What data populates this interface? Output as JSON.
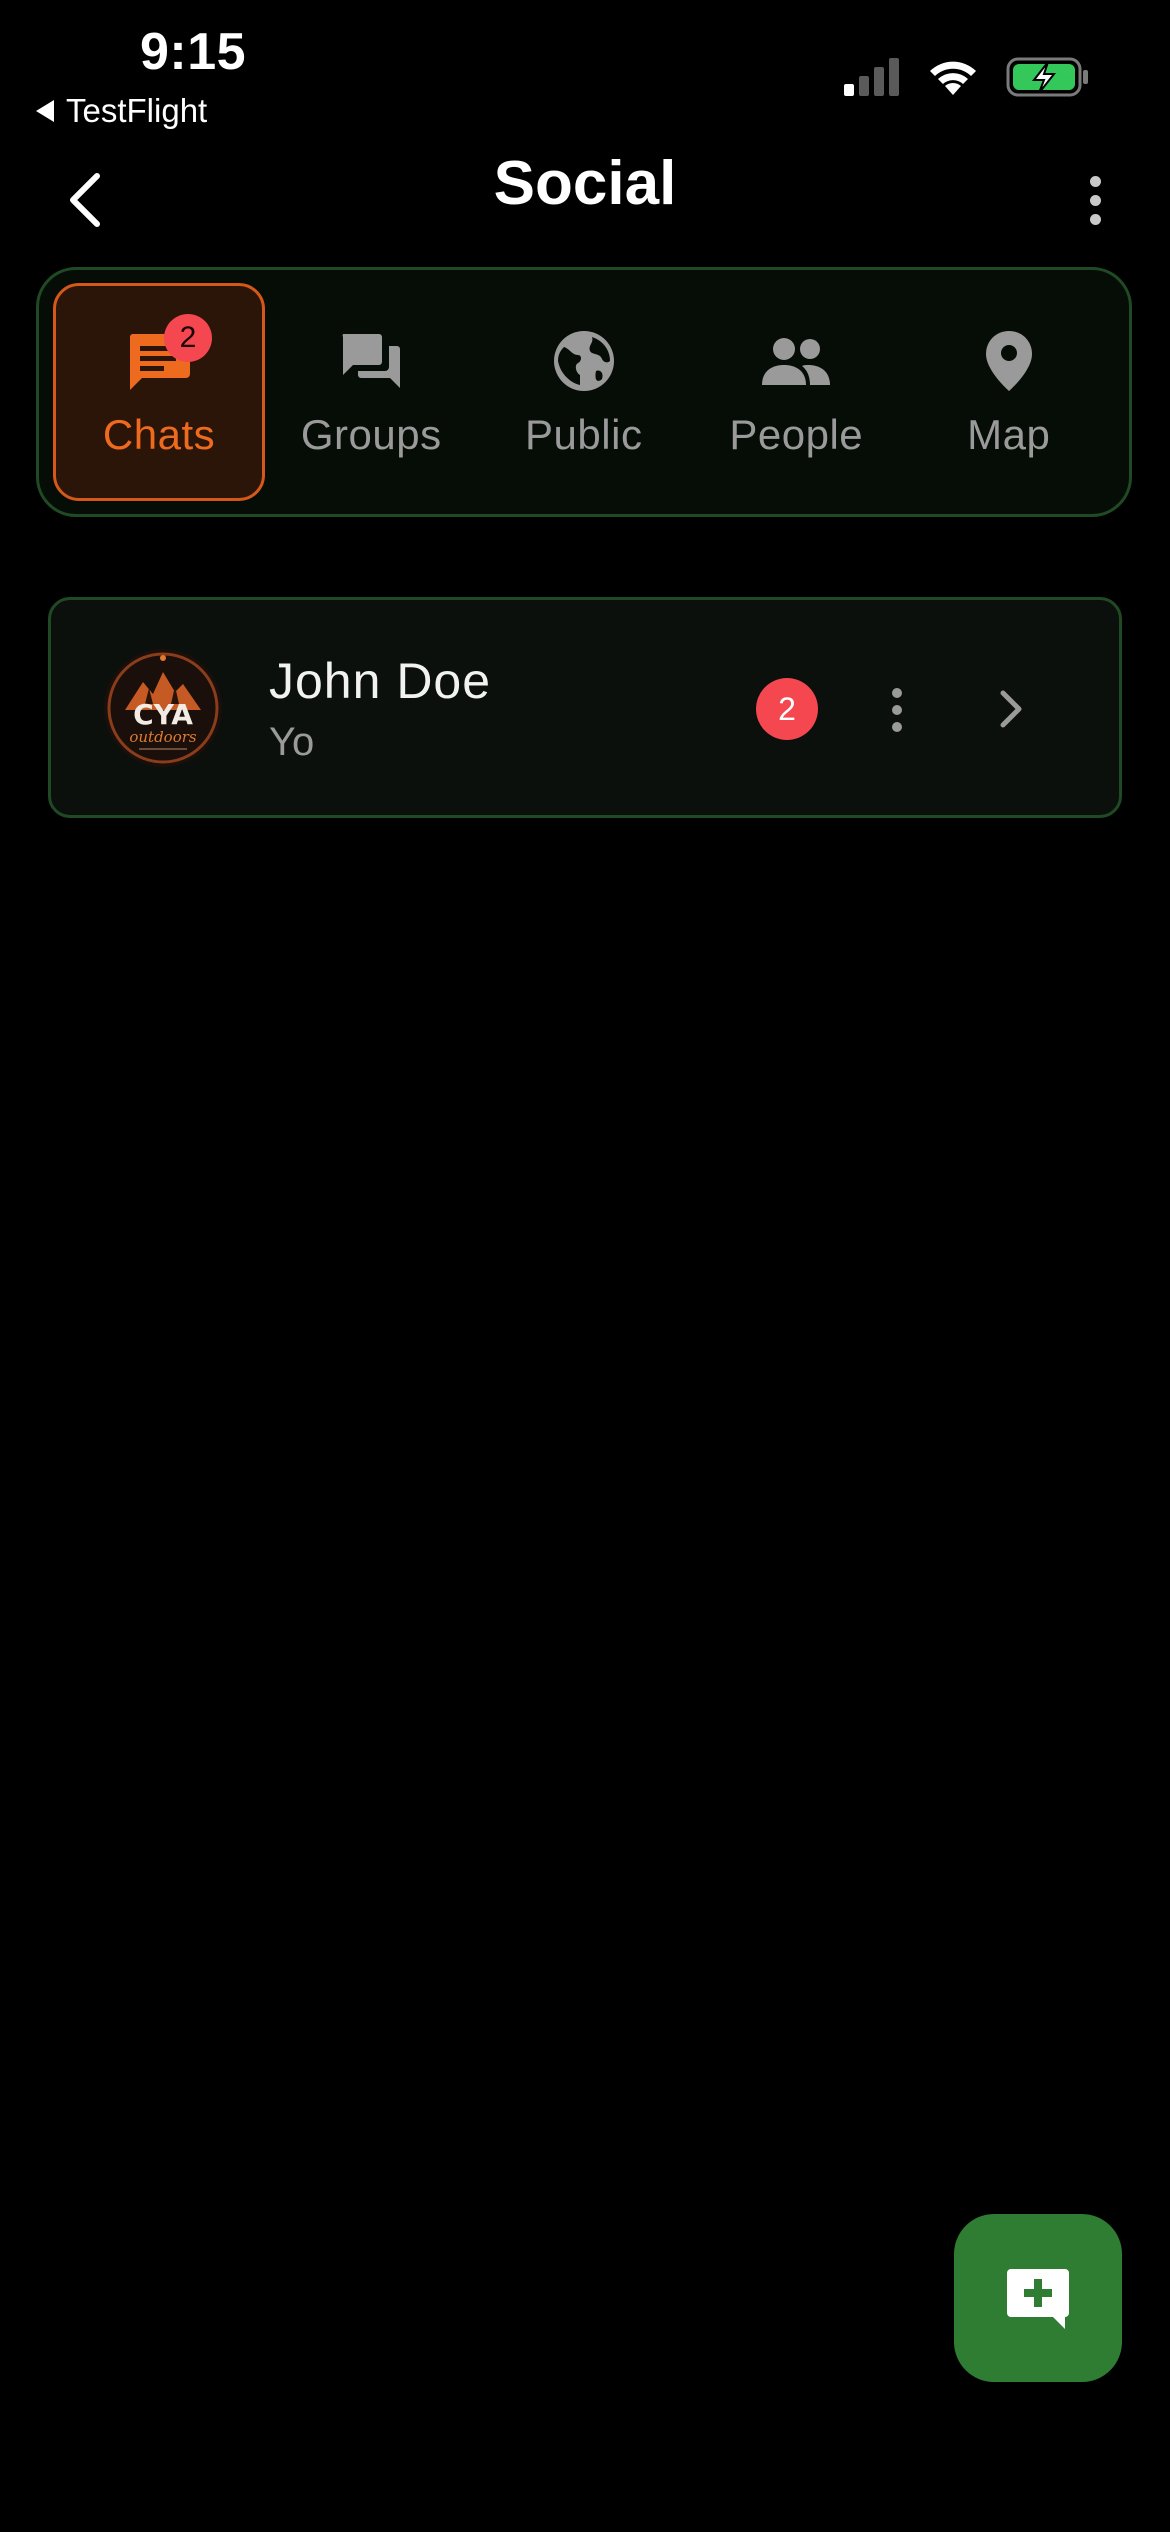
{
  "status_bar": {
    "time": "9:15",
    "back_app": "TestFlight",
    "signal_icon": "cellular-signal-icon",
    "wifi_icon": "wifi-icon",
    "battery_icon": "battery-charging-icon",
    "battery_color": "#34c759"
  },
  "header": {
    "title": "Social",
    "back_icon": "chevron-left-icon",
    "menu_icon": "more-vertical-icon"
  },
  "tabs": [
    {
      "label": "Chats",
      "icon": "chat-bubble-icon",
      "active": true,
      "badge": "2"
    },
    {
      "label": "Groups",
      "icon": "forum-icon",
      "active": false
    },
    {
      "label": "Public",
      "icon": "globe-icon",
      "active": false
    },
    {
      "label": "People",
      "icon": "people-icon",
      "active": false
    },
    {
      "label": "Map",
      "icon": "map-pin-icon",
      "active": false
    }
  ],
  "chats": [
    {
      "name": "John Doe",
      "preview": "Yo",
      "unread": "2",
      "avatar": {
        "logo_text": "CYA",
        "logo_subtext": "outdoors"
      }
    }
  ],
  "fab": {
    "icon": "add-chat-icon"
  },
  "colors": {
    "background": "#000000",
    "accent_orange": "#ee6a1e",
    "border_green": "#1f4a24",
    "fab_green": "#2e7d32",
    "badge_red": "#f5474f",
    "muted_text": "#9a9a9a"
  }
}
